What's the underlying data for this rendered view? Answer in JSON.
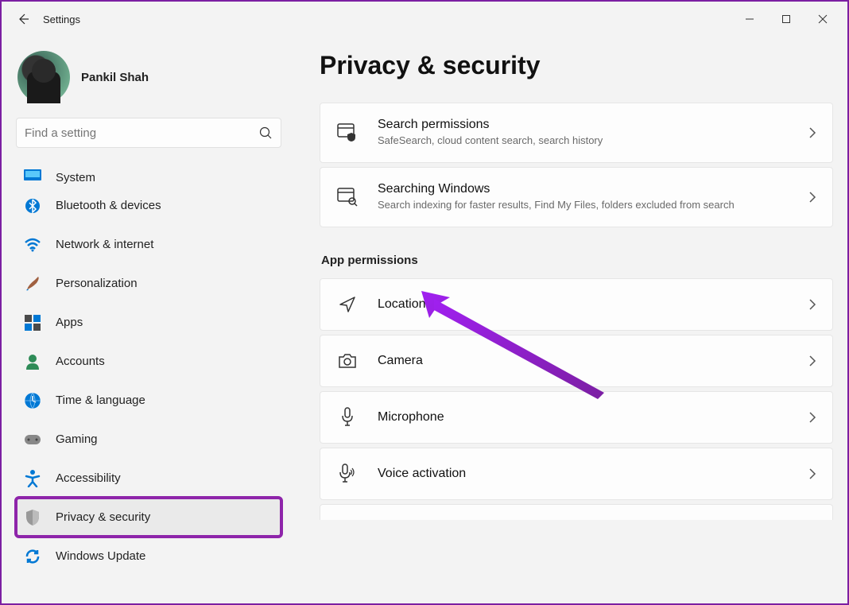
{
  "window": {
    "title": "Settings"
  },
  "user": {
    "name": "Pankil Shah"
  },
  "search": {
    "placeholder": "Find a setting"
  },
  "sidebar": [
    {
      "id": "system",
      "label": "System",
      "icon": "monitor-icon",
      "truncated": true
    },
    {
      "id": "bluetooth",
      "label": "Bluetooth & devices",
      "icon": "bluetooth-icon"
    },
    {
      "id": "network",
      "label": "Network & internet",
      "icon": "wifi-icon"
    },
    {
      "id": "personalization",
      "label": "Personalization",
      "icon": "brush-icon"
    },
    {
      "id": "apps",
      "label": "Apps",
      "icon": "apps-icon"
    },
    {
      "id": "accounts",
      "label": "Accounts",
      "icon": "person-icon"
    },
    {
      "id": "time",
      "label": "Time & language",
      "icon": "clock-globe-icon"
    },
    {
      "id": "gaming",
      "label": "Gaming",
      "icon": "gamepad-icon"
    },
    {
      "id": "accessibility",
      "label": "Accessibility",
      "icon": "accessibility-icon"
    },
    {
      "id": "privacy",
      "label": "Privacy & security",
      "icon": "shield-icon",
      "selected": true,
      "highlighted": true
    },
    {
      "id": "update",
      "label": "Windows Update",
      "icon": "sync-icon"
    }
  ],
  "page": {
    "title": "Privacy & security",
    "cards_top": [
      {
        "id": "search-permissions",
        "title": "Search permissions",
        "sub": "SafeSearch, cloud content search, search history",
        "icon": "window-shield-icon"
      },
      {
        "id": "searching-windows",
        "title": "Searching Windows",
        "sub": "Search indexing for faster results, Find My Files, folders excluded from search",
        "icon": "window-search-icon"
      }
    ],
    "section_label": "App permissions",
    "cards_perm": [
      {
        "id": "location",
        "title": "Location",
        "icon": "location-icon"
      },
      {
        "id": "camera",
        "title": "Camera",
        "icon": "camera-icon"
      },
      {
        "id": "microphone",
        "title": "Microphone",
        "icon": "microphone-icon"
      },
      {
        "id": "voice",
        "title": "Voice activation",
        "icon": "voice-icon"
      }
    ]
  }
}
